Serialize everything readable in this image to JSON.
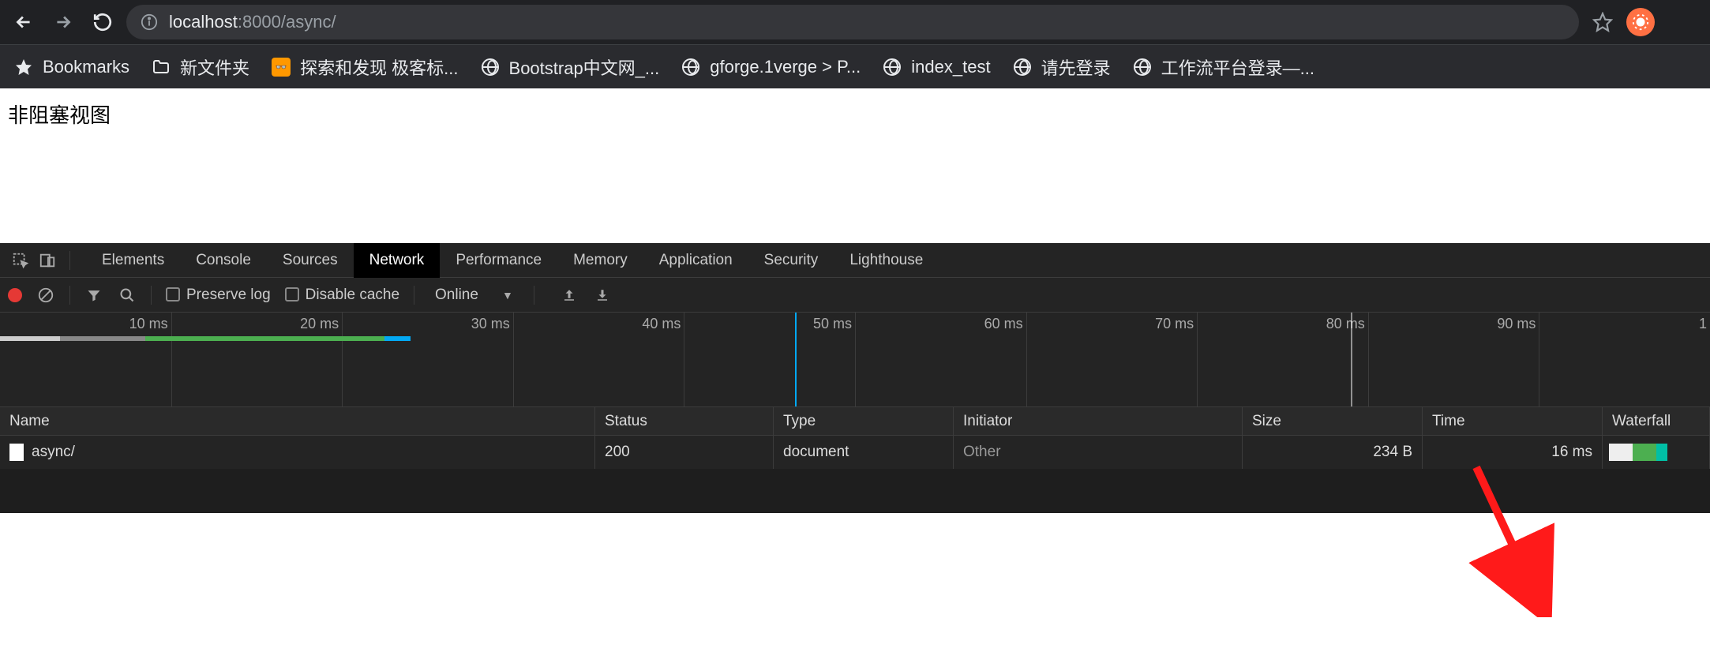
{
  "browser": {
    "url_host": "localhost",
    "url_port": ":8000",
    "url_path": "/async/",
    "bookmarks_label": "Bookmarks",
    "bookmarks": [
      {
        "icon": "folder",
        "label": "新文件夹"
      },
      {
        "icon": "orange",
        "label": "探索和发现 极客标..."
      },
      {
        "icon": "globe",
        "label": "Bootstrap中文网_..."
      },
      {
        "icon": "globe",
        "label": "gforge.1verge > P..."
      },
      {
        "icon": "globe",
        "label": "index_test"
      },
      {
        "icon": "globe",
        "label": "请先登录"
      },
      {
        "icon": "globe",
        "label": "工作流平台登录—..."
      }
    ]
  },
  "page": {
    "heading": "非阻塞视图"
  },
  "devtools": {
    "tabs": [
      "Elements",
      "Console",
      "Sources",
      "Network",
      "Performance",
      "Memory",
      "Application",
      "Security",
      "Lighthouse"
    ],
    "active_tab": "Network",
    "preserve_log_label": "Preserve log",
    "disable_cache_label": "Disable cache",
    "throttle_value": "Online",
    "timeline_ticks": [
      "10 ms",
      "20 ms",
      "30 ms",
      "40 ms",
      "50 ms",
      "60 ms",
      "70 ms",
      "80 ms",
      "90 ms",
      "1"
    ],
    "columns": {
      "name": "Name",
      "status": "Status",
      "type": "Type",
      "initiator": "Initiator",
      "size": "Size",
      "time": "Time",
      "waterfall": "Waterfall"
    },
    "rows": [
      {
        "name": "async/",
        "status": "200",
        "type": "document",
        "initiator": "Other",
        "size": "234 B",
        "time": "16 ms"
      }
    ]
  }
}
